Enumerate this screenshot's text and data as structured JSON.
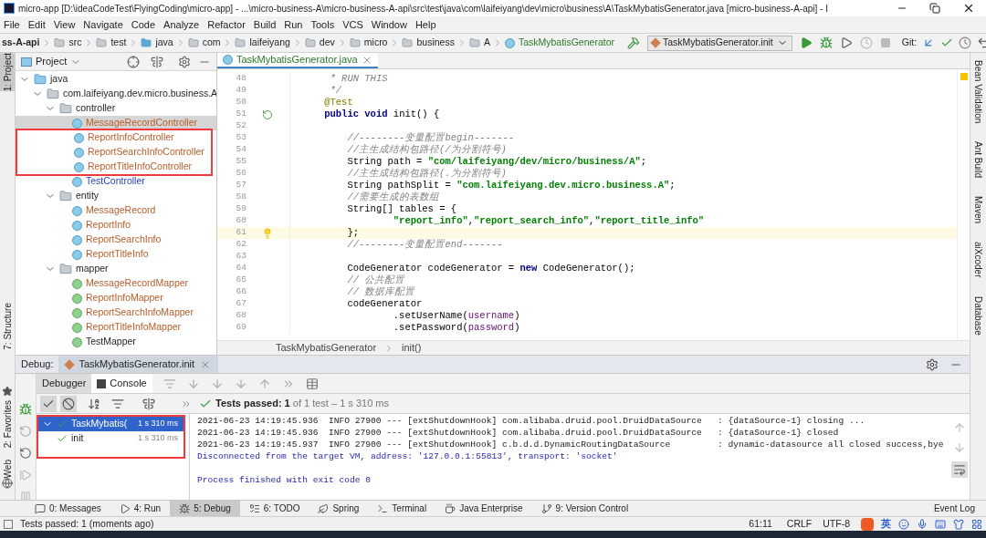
{
  "window": {
    "title": "micro-app [D:\\ideaCodeTest\\FlyingCoding\\micro-app] - ...\\micro-business-A\\micro-business-A-api\\src\\test\\java\\com\\laifeiyang\\dev\\micro\\business\\A\\TaskMybatisGenerator.java [micro-business-A-api] - I"
  },
  "menu": [
    "File",
    "Edit",
    "View",
    "Navigate",
    "Code",
    "Analyze",
    "Refactor",
    "Build",
    "Run",
    "Tools",
    "VCS",
    "Window",
    "Help"
  ],
  "navbar": {
    "crumbs": [
      {
        "label": "ss-A-api",
        "kind": "module"
      },
      {
        "label": "src",
        "kind": "folder"
      },
      {
        "label": "test",
        "kind": "folder"
      },
      {
        "label": "java",
        "kind": "source"
      },
      {
        "label": "com",
        "kind": "folder"
      },
      {
        "label": "laifeiyang",
        "kind": "folder"
      },
      {
        "label": "dev",
        "kind": "folder"
      },
      {
        "label": "micro",
        "kind": "folder"
      },
      {
        "label": "business",
        "kind": "folder"
      },
      {
        "label": "A",
        "kind": "folder"
      },
      {
        "label": "TaskMybatisGenerator",
        "kind": "class"
      }
    ],
    "run_config": "TaskMybatisGenerator.init",
    "vcs_label": "Git:"
  },
  "left_stripe": [
    {
      "label": "1: Project",
      "selected": true
    },
    {
      "label": "7: Structure",
      "selected": false
    },
    {
      "label": "2: Favorites",
      "selected": false
    },
    {
      "label": "Web",
      "selected": false
    }
  ],
  "right_stripe": [
    "Bean Validation",
    "Ant Build",
    "Maven",
    "aiXcoder",
    "Database"
  ],
  "project": {
    "title": "Project",
    "tree": [
      {
        "label": "java",
        "kind": "source",
        "expanded": true,
        "children": [
          {
            "label": "com.laifeiyang.dev.micro.business.A",
            "kind": "package",
            "expanded": true,
            "children": [
              {
                "label": "controller",
                "kind": "package",
                "expanded": true,
                "children": [
                  {
                    "label": "MessageRecordController",
                    "kind": "class",
                    "color": "#b85c27",
                    "selected": true,
                    "marked": false
                  },
                  {
                    "label": "ReportInfoController",
                    "kind": "class",
                    "color": "#b85c27",
                    "selected": false,
                    "marked": true
                  },
                  {
                    "label": "ReportSearchInfoController",
                    "kind": "class",
                    "color": "#b85c27",
                    "selected": false,
                    "marked": true
                  },
                  {
                    "label": "ReportTitleInfoController",
                    "kind": "class",
                    "color": "#b85c27",
                    "selected": false,
                    "marked": true
                  },
                  {
                    "label": "TestController",
                    "kind": "class",
                    "color": "#2a3fbf",
                    "selected": false,
                    "marked": false
                  }
                ]
              },
              {
                "label": "entity",
                "kind": "package",
                "expanded": true,
                "children": [
                  {
                    "label": "MessageRecord",
                    "kind": "class",
                    "color": "#b85c27",
                    "selected": false,
                    "marked": false
                  },
                  {
                    "label": "ReportInfo",
                    "kind": "class",
                    "color": "#b85c27",
                    "selected": false,
                    "marked": false
                  },
                  {
                    "label": "ReportSearchInfo",
                    "kind": "class",
                    "color": "#b85c27",
                    "selected": false,
                    "marked": false
                  },
                  {
                    "label": "ReportTitleInfo",
                    "kind": "class",
                    "color": "#b85c27",
                    "selected": false,
                    "marked": false
                  }
                ]
              },
              {
                "label": "mapper",
                "kind": "package",
                "expanded": true,
                "children": [
                  {
                    "label": "MessageRecordMapper",
                    "kind": "interface",
                    "color": "#b85c27",
                    "selected": false,
                    "marked": false
                  },
                  {
                    "label": "ReportInfoMapper",
                    "kind": "interface",
                    "color": "#b85c27",
                    "selected": false,
                    "marked": false
                  },
                  {
                    "label": "ReportSearchInfoMapper",
                    "kind": "interface",
                    "color": "#b85c27",
                    "selected": false,
                    "marked": false
                  },
                  {
                    "label": "ReportTitleInfoMapper",
                    "kind": "interface",
                    "color": "#b85c27",
                    "selected": false,
                    "marked": false
                  },
                  {
                    "label": "TestMapper",
                    "kind": "interface",
                    "color": "#1f1f1f",
                    "selected": false,
                    "marked": false
                  }
                ]
              }
            ]
          }
        ]
      }
    ]
  },
  "editor": {
    "tab": "TaskMybatisGenerator.java",
    "lines": [
      {
        "number": "48",
        "current": false,
        "tokens": [
          {
            "kind": "comment",
            "text": "     * RUN THIS"
          }
        ]
      },
      {
        "number": "49",
        "current": false,
        "tokens": [
          {
            "kind": "comment",
            "text": "     */"
          }
        ]
      },
      {
        "number": "50",
        "current": false,
        "tokens": [
          {
            "kind": "annotation",
            "text": "    @Test"
          }
        ]
      },
      {
        "number": "51",
        "current": false,
        "kind": "run",
        "tokens": [
          {
            "kind": "keyword",
            "text": "    public void "
          },
          {
            "kind": "plain",
            "text": "init() {"
          }
        ]
      },
      {
        "number": "52",
        "current": false
      },
      {
        "number": "53",
        "current": false,
        "tokens": [
          {
            "kind": "comment",
            "text": "        //--------变量配置begin-------"
          }
        ]
      },
      {
        "number": "54",
        "current": false,
        "tokens": [
          {
            "kind": "comment",
            "text": "        //主生成结构包路径(/为分割符号)"
          }
        ]
      },
      {
        "number": "55",
        "current": false,
        "tokens": [
          {
            "kind": "plain",
            "text": "        String path = "
          },
          {
            "kind": "string",
            "text": "\"com/laifeiyang/dev/micro/business/A\""
          },
          {
            "kind": "plain",
            "text": ";"
          }
        ]
      },
      {
        "number": "56",
        "current": false,
        "tokens": [
          {
            "kind": "comment",
            "text": "        //主生成结构包路径(.为分割符号)"
          }
        ]
      },
      {
        "number": "57",
        "current": false,
        "tokens": [
          {
            "kind": "plain",
            "text": "        String pathSplit = "
          },
          {
            "kind": "string",
            "text": "\"com.laifeiyang.dev.micro.business.A\""
          },
          {
            "kind": "plain",
            "text": ";"
          }
        ]
      },
      {
        "number": "58",
        "current": false,
        "tokens": [
          {
            "kind": "comment",
            "text": "        //需要生成的表数组"
          }
        ]
      },
      {
        "number": "59",
        "current": false,
        "tokens": [
          {
            "kind": "plain",
            "text": "        String[] tables = {"
          }
        ]
      },
      {
        "number": "60",
        "current": false,
        "tokens": [
          {
            "kind": "string",
            "text": "                \"report_info\""
          },
          {
            "kind": "plain",
            "text": ","
          },
          {
            "kind": "string",
            "text": "\"report_search_info\""
          },
          {
            "kind": "plain",
            "text": ","
          },
          {
            "kind": "string",
            "text": "\"report_title_info\""
          }
        ]
      },
      {
        "number": "61",
        "current": true,
        "kind": "bulb",
        "tokens": [
          {
            "kind": "plain",
            "text": "        };"
          }
        ]
      },
      {
        "number": "62",
        "current": false,
        "tokens": [
          {
            "kind": "comment",
            "text": "        //--------变量配置end-------"
          }
        ]
      },
      {
        "number": "63",
        "current": false
      },
      {
        "number": "64",
        "current": false,
        "tokens": [
          {
            "kind": "plain",
            "text": "        CodeGenerator codeGenerator = "
          },
          {
            "kind": "keyword",
            "text": "new "
          },
          {
            "kind": "plain",
            "text": "CodeGenerator();"
          }
        ]
      },
      {
        "number": "65",
        "current": false,
        "tokens": [
          {
            "kind": "comment",
            "text": "        // 公共配置"
          }
        ]
      },
      {
        "number": "66",
        "current": false,
        "tokens": [
          {
            "kind": "comment",
            "text": "        // 数据库配置"
          }
        ]
      },
      {
        "number": "67",
        "current": false,
        "tokens": [
          {
            "kind": "plain",
            "text": "        codeGenerator"
          }
        ]
      },
      {
        "number": "68",
        "current": false,
        "tokens": [
          {
            "kind": "plain",
            "text": "                .setUserName("
          },
          {
            "kind": "field",
            "text": "username"
          },
          {
            "kind": "plain",
            "text": ")"
          }
        ]
      },
      {
        "number": "69",
        "current": false,
        "tokens": [
          {
            "kind": "plain",
            "text": "                .setPassword("
          },
          {
            "kind": "field",
            "text": "password"
          },
          {
            "kind": "plain",
            "text": ")"
          }
        ]
      }
    ],
    "breadcrumb": [
      "TaskMybatisGenerator",
      "init()"
    ]
  },
  "debug": {
    "title": "Debug:",
    "session": "TaskMybatisGenerator.init",
    "tabs": [
      {
        "label": "Debugger",
        "selected": false
      },
      {
        "label": "Console",
        "selected": true
      }
    ],
    "summary": {
      "passed": "Tests passed: 1",
      "rest": "of 1 test – 1 s 310 ms"
    },
    "test_tree": {
      "marked": true,
      "items": [
        {
          "label": "TaskMybatis(",
          "time": "1 s 310 ms",
          "selected": true,
          "passed": true,
          "children": [
            {
              "label": "init",
              "time": "1 s 310 ms",
              "selected": false,
              "passed": true
            }
          ]
        }
      ]
    },
    "console": [
      {
        "kind": "log",
        "text": "2021-06-23 14:19:45.936  INFO 27900 --- [extShutdownHook] com.alibaba.druid.pool.DruidDataSource   : {dataSource-1} closing ..."
      },
      {
        "kind": "log",
        "text": "2021-06-23 14:19:45.936  INFO 27900 --- [extShutdownHook] com.alibaba.druid.pool.DruidDataSource   : {dataSource-1} closed"
      },
      {
        "kind": "log",
        "text": "2021-06-23 14:19:45.937  INFO 27900 --- [extShutdownHook] c.b.d.d.DynamicRoutingDataSource         : dynamic-datasource all closed success,bye"
      },
      {
        "kind": "system",
        "text": "Disconnected from the target VM, address: '127.0.0.1:55813', transport: 'socket'"
      },
      {
        "kind": "blank"
      },
      {
        "kind": "system",
        "text": "Process finished with exit code 0"
      }
    ]
  },
  "tool_windows": [
    {
      "label": "0: Messages",
      "selected": false,
      "kind": "messages"
    },
    {
      "label": "4: Run",
      "selected": false,
      "kind": "run"
    },
    {
      "label": "5: Debug",
      "selected": true,
      "kind": "debug"
    },
    {
      "label": "6: TODO",
      "selected": false,
      "kind": "todo"
    },
    {
      "label": "Spring",
      "selected": false,
      "kind": "spring"
    },
    {
      "label": "Terminal",
      "selected": false,
      "kind": "terminal"
    },
    {
      "label": "Java Enterprise",
      "selected": false,
      "kind": "enterprise"
    },
    {
      "label": "9: Version Control",
      "selected": false,
      "kind": "vcs"
    }
  ],
  "event_log": "Event Log",
  "status": {
    "message": "Tests passed: 1 (moments ago)",
    "position": "61:11",
    "line_separator": "CRLF",
    "encoding": "UTF-8",
    "ime_mode": "英"
  }
}
